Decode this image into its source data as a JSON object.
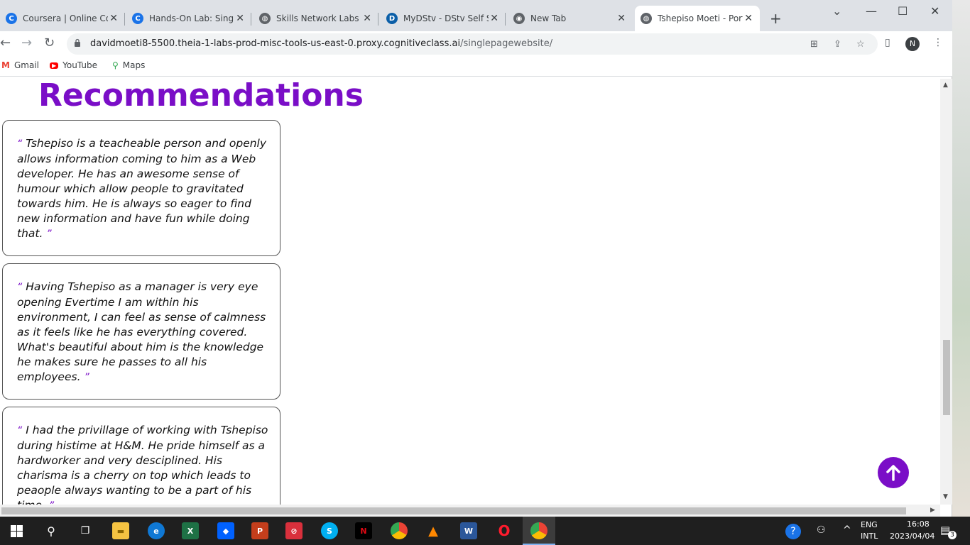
{
  "tabs": [
    {
      "title": "Coursera | Online Cou",
      "icon": "coursera-icon",
      "icon_letter": "C",
      "color": "#1a73e8"
    },
    {
      "title": "Hands-On Lab: Single",
      "icon": "coursera-icon",
      "icon_letter": "C",
      "color": "#1a73e8"
    },
    {
      "title": "Skills Network Labs",
      "icon": "globe-icon",
      "icon_letter": "◍",
      "color": "#5f6368"
    },
    {
      "title": "MyDStv - DStv Self Se",
      "icon": "dstv-icon",
      "icon_letter": "D",
      "color": "#0b5fa8"
    },
    {
      "title": "New Tab",
      "icon": "chrome-icon",
      "icon_letter": "◉",
      "color": "#5f6368"
    },
    {
      "title": "Tshepiso Moeti - Port",
      "icon": "globe-icon",
      "icon_letter": "◍",
      "color": "#5f6368"
    }
  ],
  "address": {
    "host": "davidmoeti8-5500.theia-1-labs-prod-misc-tools-us-east-0.proxy.cognitiveclass.ai",
    "path": "/singlepagewebsite/"
  },
  "profile_initial": "N",
  "bookmarks": [
    {
      "label": "Gmail",
      "icon": "gmail-icon"
    },
    {
      "label": "YouTube",
      "icon": "youtube-icon"
    },
    {
      "label": "Maps",
      "icon": "maps-icon"
    }
  ],
  "page": {
    "heading": "Recommendations",
    "open_quote": "“",
    "close_quote": "”",
    "recommendations": [
      {
        "text": "Tshepiso is a teacheable person and openly allows information coming to him as a Web developer. He has an awesome sense of humour which allow people to gravitated towards him. He is always so eager to find new information and have fun while doing that."
      },
      {
        "text": "Having Tshepiso as a manager is very eye opening Evertime I am within his environment, I can feel as sense of calmness as it feels like he has everything covered. What's beautiful about him is the knowledge he makes sure he passes to all his employees."
      },
      {
        "text": "I had the privillage of working with Tshepiso during histime at H&M. He pride himself as a hardworker and very desciplined. His charisma is a cherry on top which leads to peaople always wanting to be a part of his time."
      }
    ]
  },
  "taskbar": {
    "lang_top": "ENG",
    "lang_bottom": "INTL",
    "time": "16:08",
    "date": "2023/04/04",
    "notification_count": "3"
  },
  "colors": {
    "accent": "#7a0ec7"
  }
}
